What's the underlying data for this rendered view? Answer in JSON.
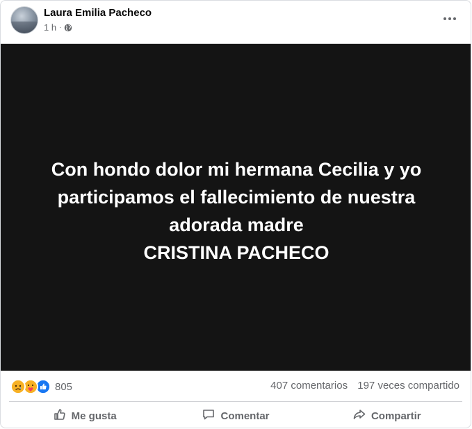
{
  "post": {
    "author": "Laura Emilia Pacheco",
    "time": "1 h",
    "audience_icon": "globe-icon",
    "more_icon": "more-options-icon"
  },
  "image": {
    "lines": [
      "Con hondo dolor mi hermana Cecilia y yo",
      "participamos el fallecimiento de nuestra",
      "adorada madre",
      "CRISTINA PACHECO"
    ],
    "background": "#141414",
    "text_color": "#ffffff"
  },
  "stats": {
    "reaction_icons": [
      "sad-reaction-icon",
      "care-reaction-icon",
      "like-reaction-icon"
    ],
    "reactions_count": "805",
    "comments": "407 comentarios",
    "shares": "197 veces compartido"
  },
  "actions": {
    "like": "Me gusta",
    "comment": "Comentar",
    "share": "Compartir"
  },
  "colors": {
    "secondary_text": "#65676b",
    "like_blue": "#1877f2",
    "emoji_yellow": "#f7b125"
  }
}
